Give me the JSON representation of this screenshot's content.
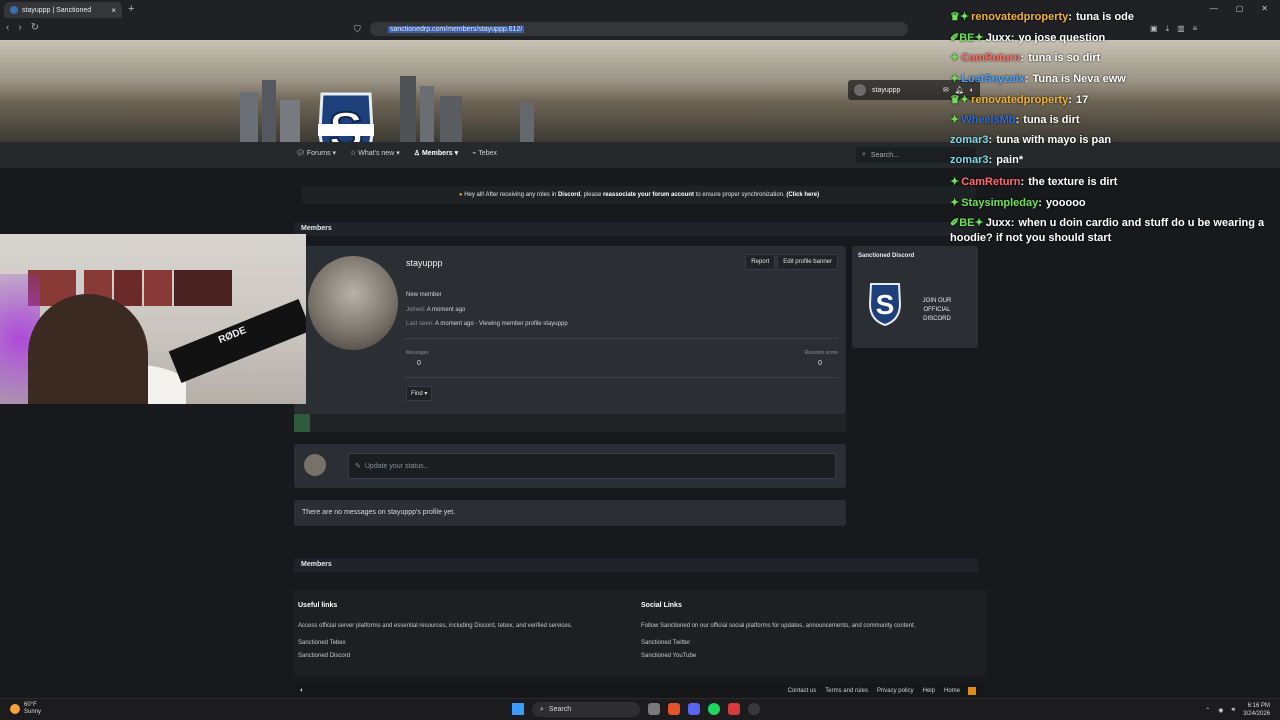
{
  "browser": {
    "tab_title": "stayuppp | Sanctioned",
    "url": "sanctionedrp.com/members/stayuppp.612/",
    "new_tab": "+"
  },
  "user_chip": {
    "username": "stayuppp"
  },
  "nav": {
    "items": [
      {
        "label": "Forums"
      },
      {
        "label": "What's new"
      },
      {
        "label": "Members"
      },
      {
        "label": "Tebex"
      }
    ],
    "search_placeholder": "Search..."
  },
  "notice": {
    "pre": "Hey all! After receiving any roles in ",
    "discord": "Discord",
    "mid": ", please ",
    "reassociate": "reassociate your forum account",
    "post": " to ensure proper synchronization. ",
    "click": "(Click here)"
  },
  "breadcrumb": {
    "label": "Members"
  },
  "profile": {
    "name": "stayuppp",
    "role": "New member",
    "joined_label": "Joined:",
    "joined_value": "A moment ago",
    "last_seen_label": "Last seen:",
    "last_seen_value": "A moment ago · Viewing member profile stayuppp",
    "report": "Report",
    "edit_banner": "Edit profile banner",
    "messages_label": "Messages",
    "messages_value": "0",
    "reaction_label": "Reaction score",
    "reaction_value": "0",
    "find": "Find ▾"
  },
  "sidebar": {
    "title": "Sanctioned Discord",
    "cta": "JOIN OUR OFFICIAL DISCORD"
  },
  "status": {
    "placeholder": "Update your status..."
  },
  "no_messages": "There are no messages on stayuppp's profile yet.",
  "footer": {
    "useful_title": "Useful links",
    "useful_desc": "Access official server platforms and essential resources, including Discord, tebex, and verified services.",
    "useful_links": [
      "Sanctioned Tebex",
      "Sanctioned Discord"
    ],
    "social_title": "Social Links",
    "social_desc": "Follow Sanctioned on our official social platforms for updates, announcements, and community content.",
    "social_links": [
      "Sanctioned Twitter",
      "Sanctioned YouTube"
    ],
    "bottom_links": [
      "Contact us",
      "Terms and rules",
      "Privacy policy",
      "Help",
      "Home"
    ]
  },
  "chat": [
    {
      "user": "renovatedproperty",
      "msg": "tuna is ode",
      "color": "#f0b23a",
      "badge": "♛✦"
    },
    {
      "user": "Juxx",
      "msg": "yo jose question",
      "color": "#ffffff",
      "badge": "✐BE✦"
    },
    {
      "user": "CamReturn",
      "msg": "tuna is so dirt",
      "color": "#ff6b6b",
      "badge": "✦"
    },
    {
      "user": "LostSeyzaix",
      "msg": "Tuna is Neva eww",
      "color": "#4aa3ff",
      "badge": "✦"
    },
    {
      "user": "renovatedproperty",
      "msg": "17",
      "color": "#f0b23a",
      "badge": "♛✦"
    },
    {
      "user": "WheelsMb",
      "msg": "tuna is dirt",
      "color": "#2f6dd8",
      "badge": "✦"
    },
    {
      "user": "zomar3",
      "msg": "tuna with mayo is pan",
      "color": "#7fd8e8",
      "badge": ""
    },
    {
      "user": "zomar3",
      "msg": "pain*",
      "color": "#7fd8e8",
      "badge": ""
    },
    {
      "user": "CamReturn",
      "msg": "the texture is dirt",
      "color": "#ff6b6b",
      "badge": "✦"
    },
    {
      "user": "Staysimpleday",
      "msg": "yooooo",
      "color": "#6fe05a",
      "badge": "✦"
    },
    {
      "user": "Juxx",
      "msg": "when u doin cardio and stuff do u be wearing a",
      "color": "#ffffff",
      "badge": "✐BE✦"
    },
    {
      "user": "",
      "msg": "hoodie? if not you should start",
      "color": "#ffffff",
      "badge": ""
    }
  ],
  "webcam": {
    "mic_brand": "RØDE"
  },
  "taskbar": {
    "temp": "60°F",
    "weather": "Sunny",
    "search": "Search",
    "time": "6:16 PM",
    "date": "3/24/2026"
  },
  "colors": {
    "accent": "#3b5ea8",
    "panel": "#2b2f33",
    "bg": "#17191c"
  }
}
